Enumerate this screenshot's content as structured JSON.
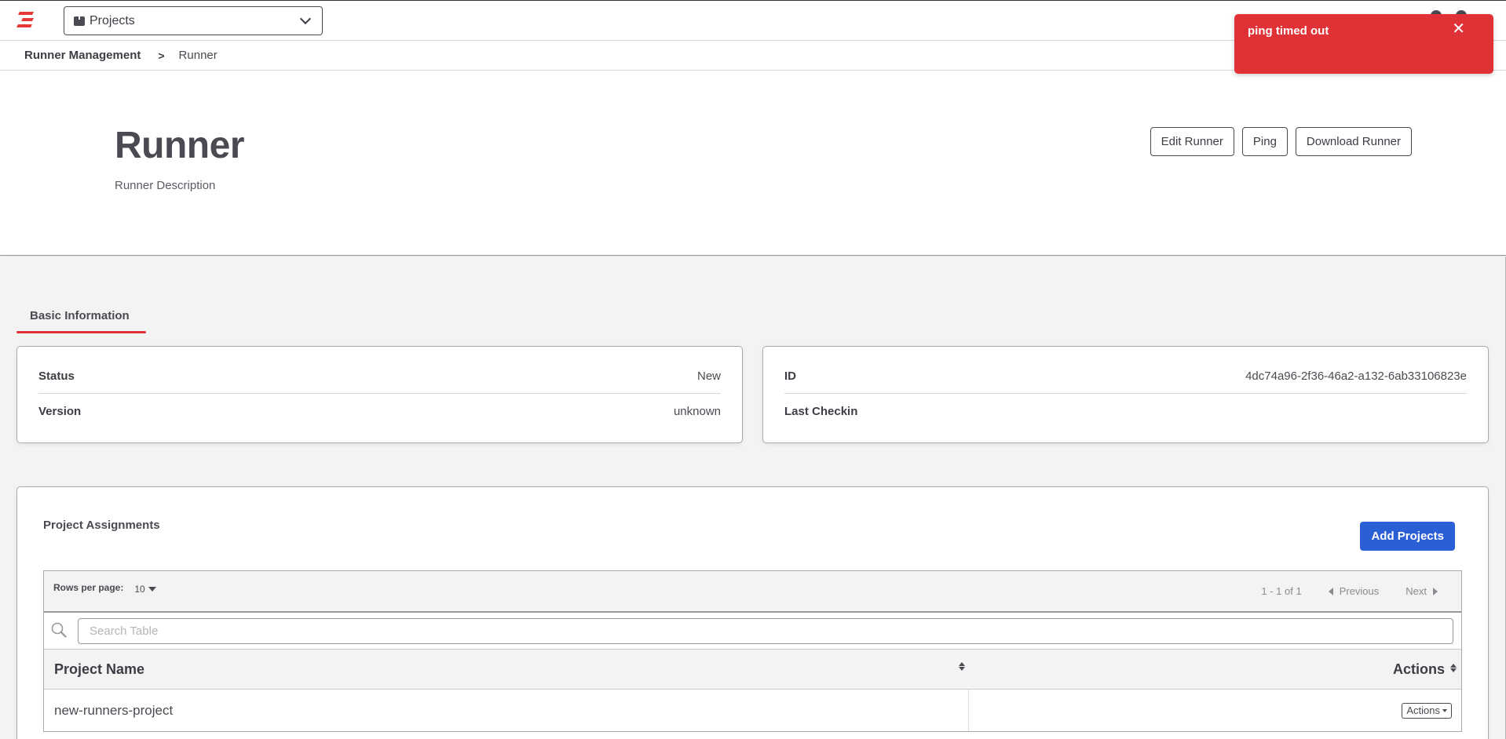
{
  "topbar": {
    "logo": "brand-logo",
    "project_selector": {
      "icon": "box-icon",
      "value": "Projects",
      "chevron": "chevron-down-icon"
    }
  },
  "breadcrumb": {
    "root": "Runner Management",
    "separator_icon": "chevron-right-icon",
    "current": "Runner"
  },
  "header": {
    "title": "Runner",
    "description": "Runner Description",
    "actions": {
      "edit": "Edit Runner",
      "ping": "Ping",
      "download": "Download Runner"
    }
  },
  "tabs": [
    {
      "label": "Basic Information",
      "active": true
    }
  ],
  "basic_info": {
    "left": [
      {
        "label": "Status",
        "value": "New"
      },
      {
        "label": "Version",
        "value": "unknown"
      }
    ],
    "right": [
      {
        "label": "ID",
        "value": "4dc74a96-2f36-46a2-a132-6ab33106823e"
      },
      {
        "label": "Last Checkin",
        "value": ""
      }
    ]
  },
  "project_assignments": {
    "title": "Project Assignments",
    "add_button": "Add Projects",
    "add_button_color": "#2a5fd6",
    "rows_per_page_label": "Rows per page:",
    "rows_per_page_value": "10",
    "range": "1 - 1 of 1",
    "previous": "Previous",
    "next": "Next",
    "search_placeholder": "Search Table",
    "search_value": "",
    "columns": [
      "Project Name",
      "Actions"
    ],
    "rows": [
      {
        "project_name": "new-runners-project",
        "actions_label": "Actions"
      }
    ]
  },
  "toast": {
    "message": "ping timed out",
    "close_icon": "close-icon",
    "color": "#e03236"
  },
  "accent_color": "#e03236"
}
